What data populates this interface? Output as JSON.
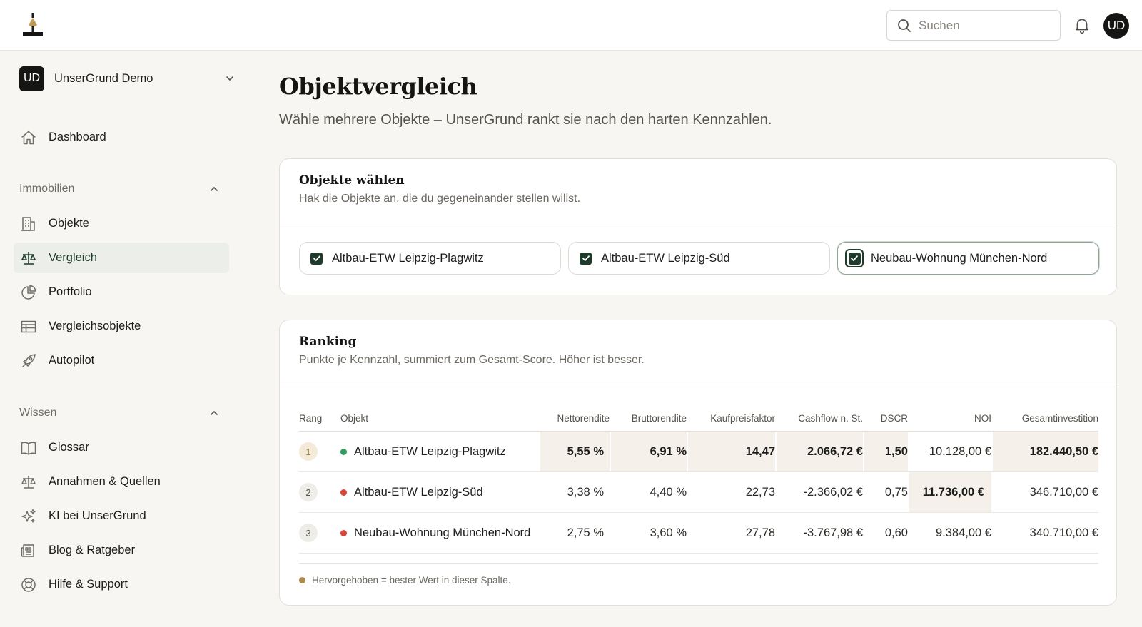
{
  "header": {
    "logo_icon": "lamp-logo-icon",
    "search_placeholder": "Suchen",
    "user_initials": "UD"
  },
  "sidebar": {
    "org": {
      "initials": "UD",
      "name": "UnserGrund Demo"
    },
    "dashboard": {
      "label": "Dashboard",
      "icon": "home-icon"
    },
    "sections": [
      {
        "label": "Immobilien",
        "items": [
          {
            "label": "Objekte",
            "icon": "building-icon"
          },
          {
            "label": "Vergleich",
            "icon": "scale-icon",
            "active": true
          },
          {
            "label": "Portfolio",
            "icon": "pie-chart-icon"
          },
          {
            "label": "Vergleichsobjekte",
            "icon": "table-icon"
          },
          {
            "label": "Autopilot",
            "icon": "rocket-icon"
          }
        ]
      },
      {
        "label": "Wissen",
        "items": [
          {
            "label": "Glossar",
            "icon": "book-icon"
          },
          {
            "label": "Annahmen & Quellen",
            "icon": "scale-icon"
          },
          {
            "label": "KI bei UnserGrund",
            "icon": "sparkles-icon"
          },
          {
            "label": "Blog & Ratgeber",
            "icon": "newspaper-icon"
          },
          {
            "label": "Hilfe & Support",
            "icon": "lifebuoy-icon"
          }
        ]
      }
    ]
  },
  "page": {
    "title": "Objektvergleich",
    "subtitle": "Wähle mehrere Objekte – UnserGrund rankt sie nach den harten Kennzahlen."
  },
  "select_card": {
    "title": "Objekte wählen",
    "desc": "Hak die Objekte an, die du gegeneinander stellen willst.",
    "options": [
      {
        "label": "Altbau-ETW Leipzig-Plagwitz",
        "checked": true
      },
      {
        "label": "Altbau-ETW Leipzig-Süd",
        "checked": true
      },
      {
        "label": "Neubau-Wohnung München-Nord",
        "checked": true,
        "focused": true
      }
    ]
  },
  "ranking_card": {
    "title": "Ranking",
    "desc": "Punkte je Kennzahl, summiert zum Gesamt-Score. Höher ist besser.",
    "columns": [
      "Rang",
      "Objekt",
      "Nettorendite",
      "Bruttorendite",
      "Kaufpreisfaktor",
      "Cashflow n. St.",
      "DSCR",
      "NOI",
      "Gesamtinvestition"
    ],
    "rows": [
      {
        "rank": "1",
        "dot_color": "#2e9a5c",
        "name": "Altbau-ETW Leipzig-Plagwitz",
        "values": [
          "5,55 %",
          "6,91 %",
          "14,47",
          "2.066,72 €",
          "1,50",
          "10.128,00 €",
          "182.440,50 €"
        ],
        "best": [
          true,
          true,
          true,
          true,
          true,
          false,
          true
        ]
      },
      {
        "rank": "2",
        "dot_color": "#d9473a",
        "name": "Altbau-ETW Leipzig-Süd",
        "values": [
          "3,38 %",
          "4,40 %",
          "22,73",
          "-2.366,02 €",
          "0,75",
          "11.736,00 €",
          "346.710,00 €"
        ],
        "best": [
          false,
          false,
          false,
          false,
          false,
          true,
          false
        ]
      },
      {
        "rank": "3",
        "dot_color": "#d9473a",
        "name": "Neubau-Wohnung München-Nord",
        "values": [
          "2,75 %",
          "3,60 %",
          "27,78",
          "-3.767,98 €",
          "0,60",
          "9.384,00 €",
          "340.710,00 €"
        ],
        "best": [
          false,
          false,
          false,
          false,
          false,
          false,
          false
        ]
      }
    ],
    "legend": "Hervorgehoben = bester Wert in dieser Spalte.",
    "legend_color": "#b08b4a"
  },
  "colors": {
    "accent": "#1f3b2c",
    "highlight_bg": "#f5f1ea"
  }
}
